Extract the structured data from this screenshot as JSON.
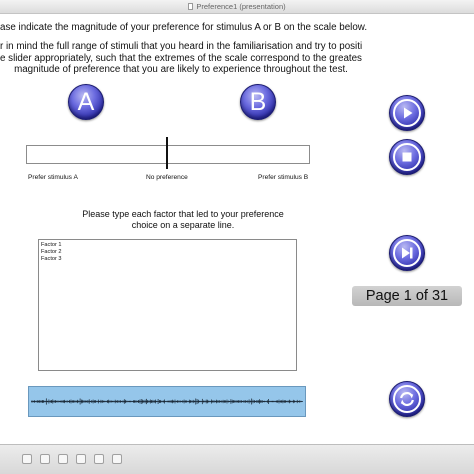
{
  "window": {
    "title": "Preference1 (presentation)"
  },
  "instructions": {
    "main": "ase indicate the magnitude of your preference for stimulus A or B on the scale below.",
    "sub_lines": [
      "r in mind the full range of stimuli that you heard in the familiarisation and try to position",
      "e slider appropriately, such that the extremes of the scale correspond to the greatest",
      "magnitude of preference that you are likely to experience throughout the test."
    ]
  },
  "stimuli": {
    "a_label": "A",
    "b_label": "B"
  },
  "scale": {
    "left_label": "Prefer stimulus A",
    "center_label": "No preference",
    "right_label": "Prefer stimulus B",
    "slider_position": 0.5
  },
  "factors": {
    "prompt_lines": [
      "Please type each factor that led to your preference",
      "choice on a separate line."
    ],
    "lines": [
      "Factor 1",
      "Factor 2",
      "Factor 3"
    ]
  },
  "page_indicator": "Page 1 of 31",
  "controls": {
    "play_icon": "play-icon",
    "stop_icon": "stop-icon",
    "next_icon": "skip-next-icon",
    "reset_icon": "refresh-icon",
    "button_color": "#2b2ba6"
  },
  "waveform_color": "#95c6ea"
}
